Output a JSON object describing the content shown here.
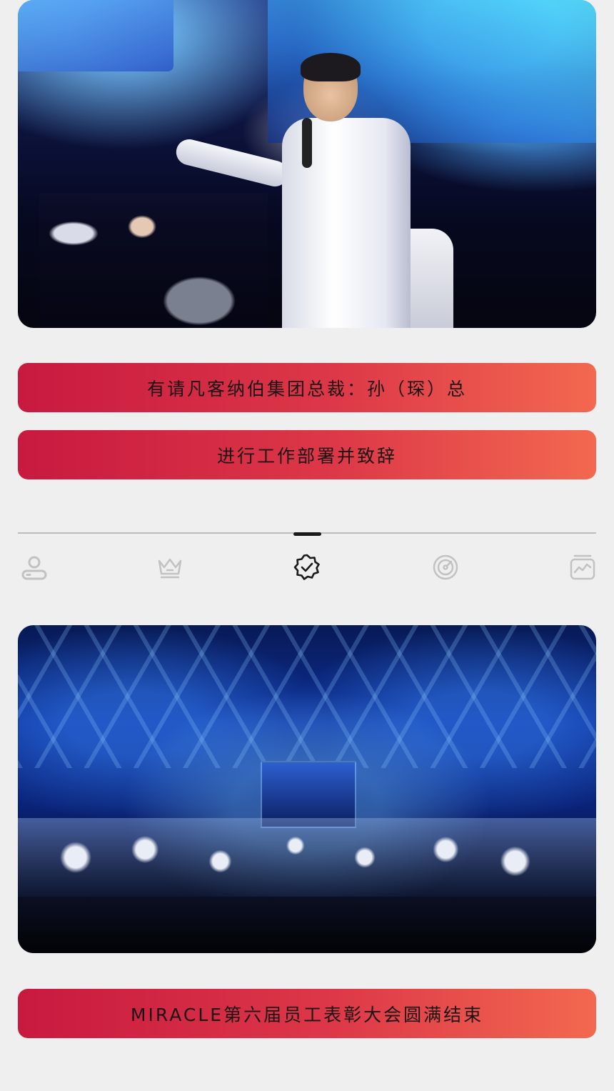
{
  "top_photo": {
    "description_icon": "speaker-photo"
  },
  "banners": {
    "invite_line": "有请凡客纳伯集团总裁：孙（琛）总",
    "speech_line": "进行工作部署并致辞",
    "closing_line": "MIRACLE第六届员工表彰大会圆满结束"
  },
  "tabs": [
    {
      "icon": "user-icon"
    },
    {
      "icon": "crown-icon"
    },
    {
      "icon": "badge-check-icon",
      "active": true
    },
    {
      "icon": "gauge-icon"
    },
    {
      "icon": "chart-icon"
    }
  ],
  "colors": {
    "banner_start": "#c8193f",
    "banner_end": "#f3684f",
    "page_bg": "#efefef",
    "tab_inactive": "#c2c2c2",
    "tab_active": "#1a1a1a"
  }
}
